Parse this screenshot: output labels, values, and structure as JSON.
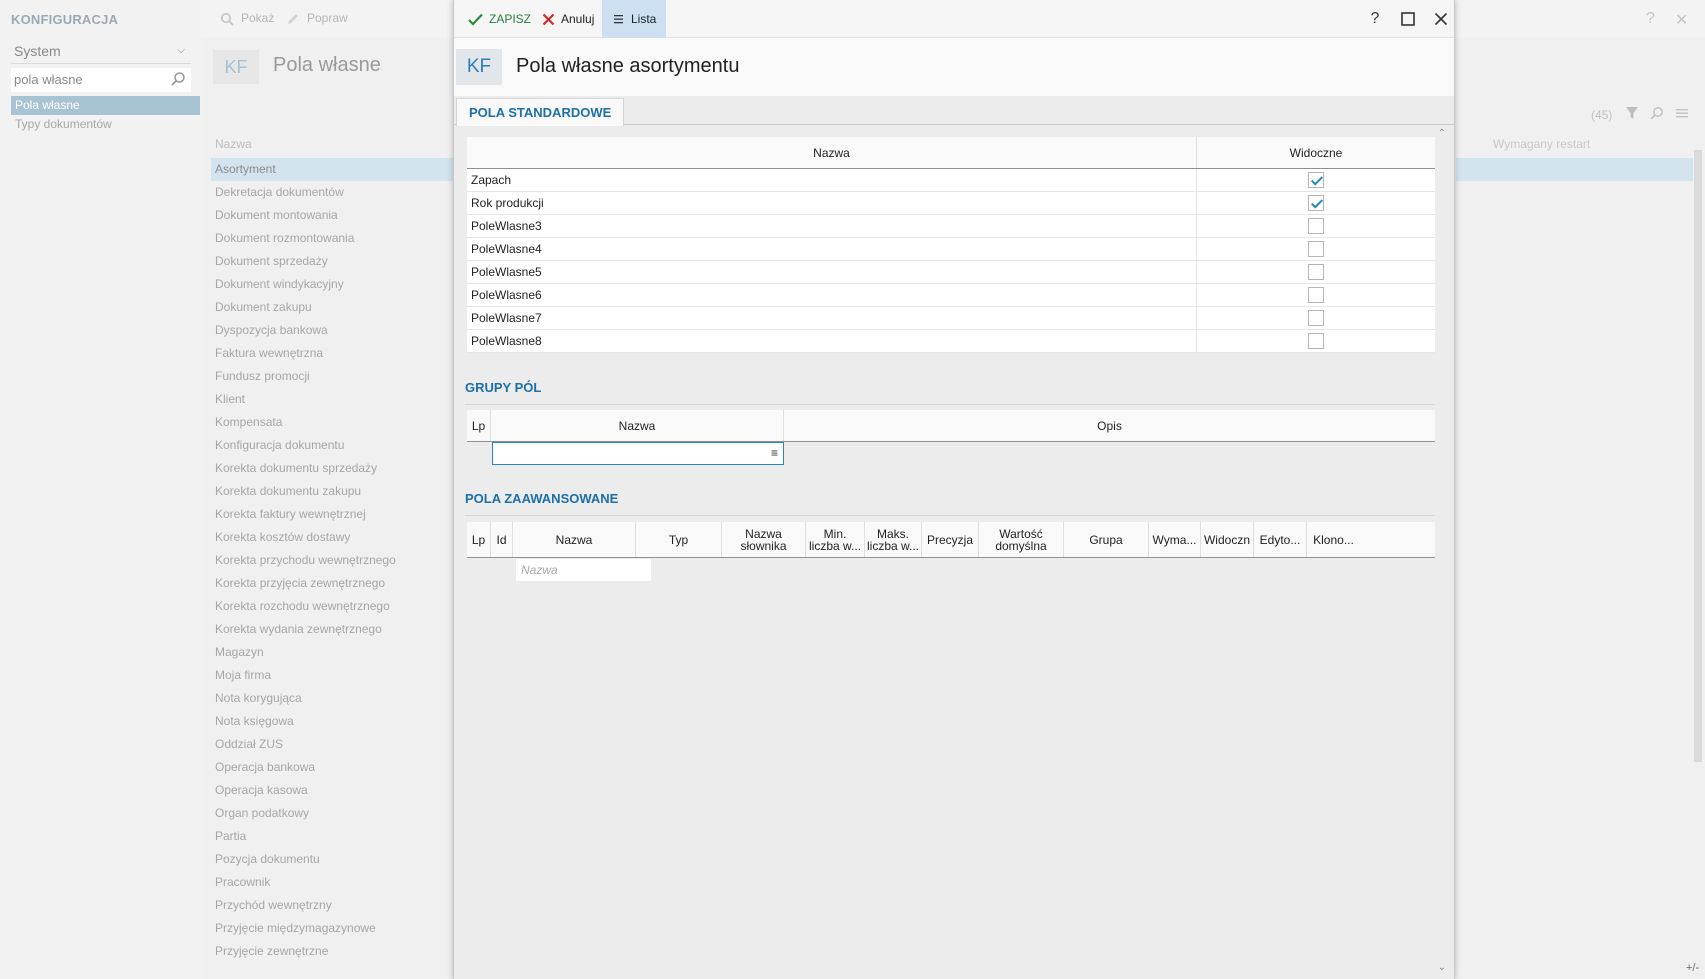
{
  "background": {
    "app_title": "KONFIGURACJA",
    "system_select": "System",
    "search_value": "pola własne",
    "nav_items": [
      "Pola własne",
      "Typy dokumentów"
    ],
    "toolbar": {
      "show": "Pokaż",
      "edit": "Popraw"
    },
    "kf": "KF",
    "page_title": "Pola własne",
    "column_name": "Nazwa",
    "column_restart": "Wymagany restart",
    "count": "(45)",
    "plus_minus": "+/-",
    "rows": [
      "Asortyment",
      "Dekretacja dokumentów",
      "Dokument montowania",
      "Dokument rozmontowania",
      "Dokument sprzedaży",
      "Dokument windykacyjny",
      "Dokument zakupu",
      "Dyspozycja bankowa",
      "Faktura wewnętrzna",
      "Fundusz promocji",
      "Klient",
      "Kompensata",
      "Konfiguracja dokumentu",
      "Korekta dokumentu sprzedaży",
      "Korekta dokumentu zakupu",
      "Korekta faktury wewnętrznej",
      "Korekta kosztów dostawy",
      "Korekta przychodu wewnętrznego",
      "Korekta przyjęcia zewnętrznego",
      "Korekta rozchodu wewnętrznego",
      "Korekta wydania zewnętrznego",
      "Magazyn",
      "Moja firma",
      "Nota korygująca",
      "Nota księgowa",
      "Oddział ZUS",
      "Operacja bankowa",
      "Operacja kasowa",
      "Organ podatkowy",
      "Partia",
      "Pozycja dokumentu",
      "Pracownik",
      "Przychód wewnętrzny",
      "Przyjęcie międzymagazynowe",
      "Przyjęcie zewnętrzne"
    ]
  },
  "modal": {
    "toolbar": {
      "save": "ZAPISZ",
      "cancel": "Anuluj",
      "list": "Lista"
    },
    "window_buttons": {
      "help": "?"
    },
    "kf": "KF",
    "title": "Pola własne asortymentu",
    "tab": "POLA STANDARDOWE",
    "standard": {
      "headers": [
        "Nazwa",
        "Widoczne"
      ],
      "rows": [
        {
          "name": "Zapach",
          "visible": true
        },
        {
          "name": "Rok produkcji",
          "visible": true
        },
        {
          "name": "PoleWlasne3",
          "visible": false
        },
        {
          "name": "PoleWlasne4",
          "visible": false
        },
        {
          "name": "PoleWlasne5",
          "visible": false
        },
        {
          "name": "PoleWlasne6",
          "visible": false
        },
        {
          "name": "PoleWlasne7",
          "visible": false
        },
        {
          "name": "PoleWlasne8",
          "visible": false
        }
      ]
    },
    "groups": {
      "title": "GRUPY PÓL",
      "headers": [
        "Lp",
        "Nazwa",
        "Opis"
      ]
    },
    "advanced": {
      "title": "POLA ZAAWANSOWANE",
      "headers": [
        "Lp",
        "Id",
        "Nazwa",
        "Typ",
        "Nazwa\nsłownika",
        "Min.\nliczba w...",
        "Maks.\nliczba w...",
        "Precyzja",
        "Wartość\ndomyślna",
        "Grupa",
        "Wyma...",
        "Widoczn",
        "Edyto...",
        "Klono..."
      ],
      "name_placeholder": "Nazwa"
    }
  }
}
